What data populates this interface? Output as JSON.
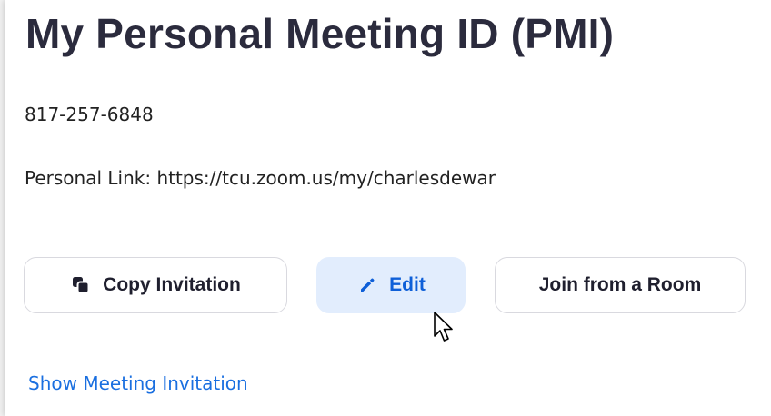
{
  "section": {
    "title": "My Personal Meeting ID (PMI)",
    "meeting_id": "817-257-6848",
    "personal_link_label": "Personal Link:",
    "personal_link_url": "https://tcu.zoom.us/my/charlesdewar"
  },
  "actions": {
    "copy_invitation_label": "Copy Invitation",
    "copy_icon": "copy-icon",
    "edit_label": "Edit",
    "edit_icon": "pencil-icon",
    "join_from_room_label": "Join from a Room"
  },
  "footer": {
    "show_invitation_label": "Show Meeting Invitation"
  },
  "colors": {
    "title_text": "#2b2b3d",
    "link_blue": "#1a6fe0",
    "edit_button_bg": "#e2edfd",
    "edit_button_text": "#0e5fd8",
    "button_border": "#d9d9df"
  }
}
